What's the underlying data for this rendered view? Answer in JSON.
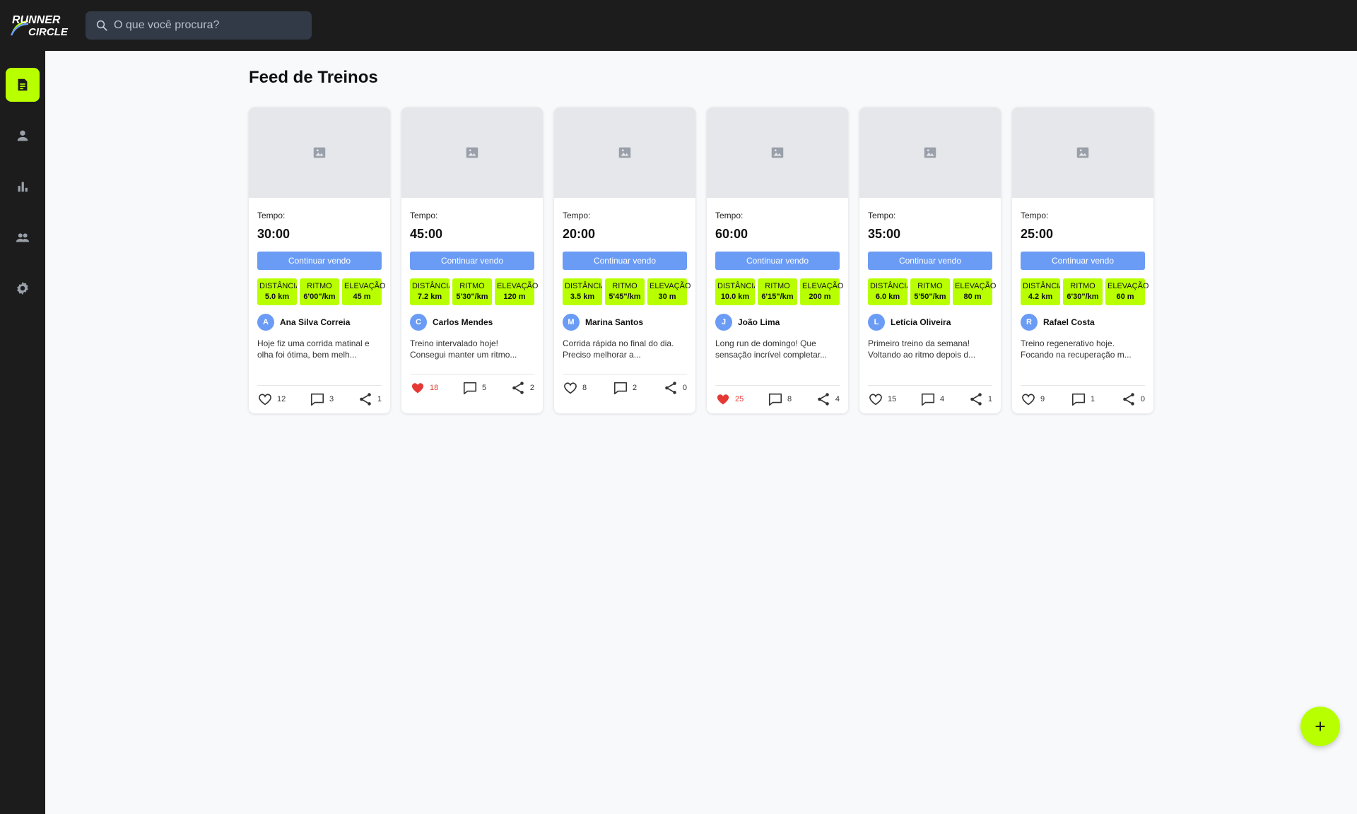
{
  "app": {
    "logo_line1": "RUNNER",
    "logo_line2": "CIRCLE"
  },
  "search": {
    "placeholder": "O que você procura?"
  },
  "sidebar": {
    "items": [
      {
        "name": "feed",
        "icon": "document-icon",
        "active": true
      },
      {
        "name": "profile",
        "icon": "person-icon",
        "active": false
      },
      {
        "name": "stats",
        "icon": "bar-chart-icon",
        "active": false
      },
      {
        "name": "community",
        "icon": "group-icon",
        "active": false
      },
      {
        "name": "settings",
        "icon": "gear-icon",
        "active": false
      }
    ]
  },
  "page": {
    "title": "Feed de Treinos"
  },
  "labels": {
    "time": "Tempo:",
    "cta": "Continuar vendo",
    "distance": "DISTÂNCIA",
    "pace": "RITMO",
    "elevation": "ELEVAÇÃO"
  },
  "colors": {
    "accent": "#b8ff00",
    "button": "#6b9cf5",
    "liked": "#e53935"
  },
  "posts": [
    {
      "time": "30:00",
      "distance": "5.0 km",
      "pace": "6'00\"/km",
      "elevation": "45 m",
      "author_initial": "A",
      "author": "Ana Silva Correia",
      "text": "Hoje fiz uma corrida matinal e olha foi ótima, bem melh...",
      "likes": "12",
      "liked": false,
      "comments": "3",
      "shares": "1"
    },
    {
      "time": "45:00",
      "distance": "7.2 km",
      "pace": "5'30\"/km",
      "elevation": "120 m",
      "author_initial": "C",
      "author": "Carlos Mendes",
      "text": "Treino intervalado hoje! Consegui manter um ritmo...",
      "likes": "18",
      "liked": true,
      "comments": "5",
      "shares": "2"
    },
    {
      "time": "20:00",
      "distance": "3.5 km",
      "pace": "5'45\"/km",
      "elevation": "30 m",
      "author_initial": "M",
      "author": "Marina Santos",
      "text": "Corrida rápida no final do dia. Preciso melhorar a...",
      "likes": "8",
      "liked": false,
      "comments": "2",
      "shares": "0"
    },
    {
      "time": "60:00",
      "distance": "10.0 km",
      "pace": "6'15\"/km",
      "elevation": "200 m",
      "author_initial": "J",
      "author": "João Lima",
      "text": "Long run de domingo! Que sensação incrível completar...",
      "likes": "25",
      "liked": true,
      "comments": "8",
      "shares": "4"
    },
    {
      "time": "35:00",
      "distance": "6.0 km",
      "pace": "5'50\"/km",
      "elevation": "80 m",
      "author_initial": "L",
      "author": "Letícia Oliveira",
      "text": "Primeiro treino da semana! Voltando ao ritmo depois d...",
      "likes": "15",
      "liked": false,
      "comments": "4",
      "shares": "1"
    },
    {
      "time": "25:00",
      "distance": "4.2 km",
      "pace": "6'30\"/km",
      "elevation": "60 m",
      "author_initial": "R",
      "author": "Rafael Costa",
      "text": "Treino regenerativo hoje. Focando na recuperação m...",
      "likes": "9",
      "liked": false,
      "comments": "1",
      "shares": "0"
    }
  ]
}
